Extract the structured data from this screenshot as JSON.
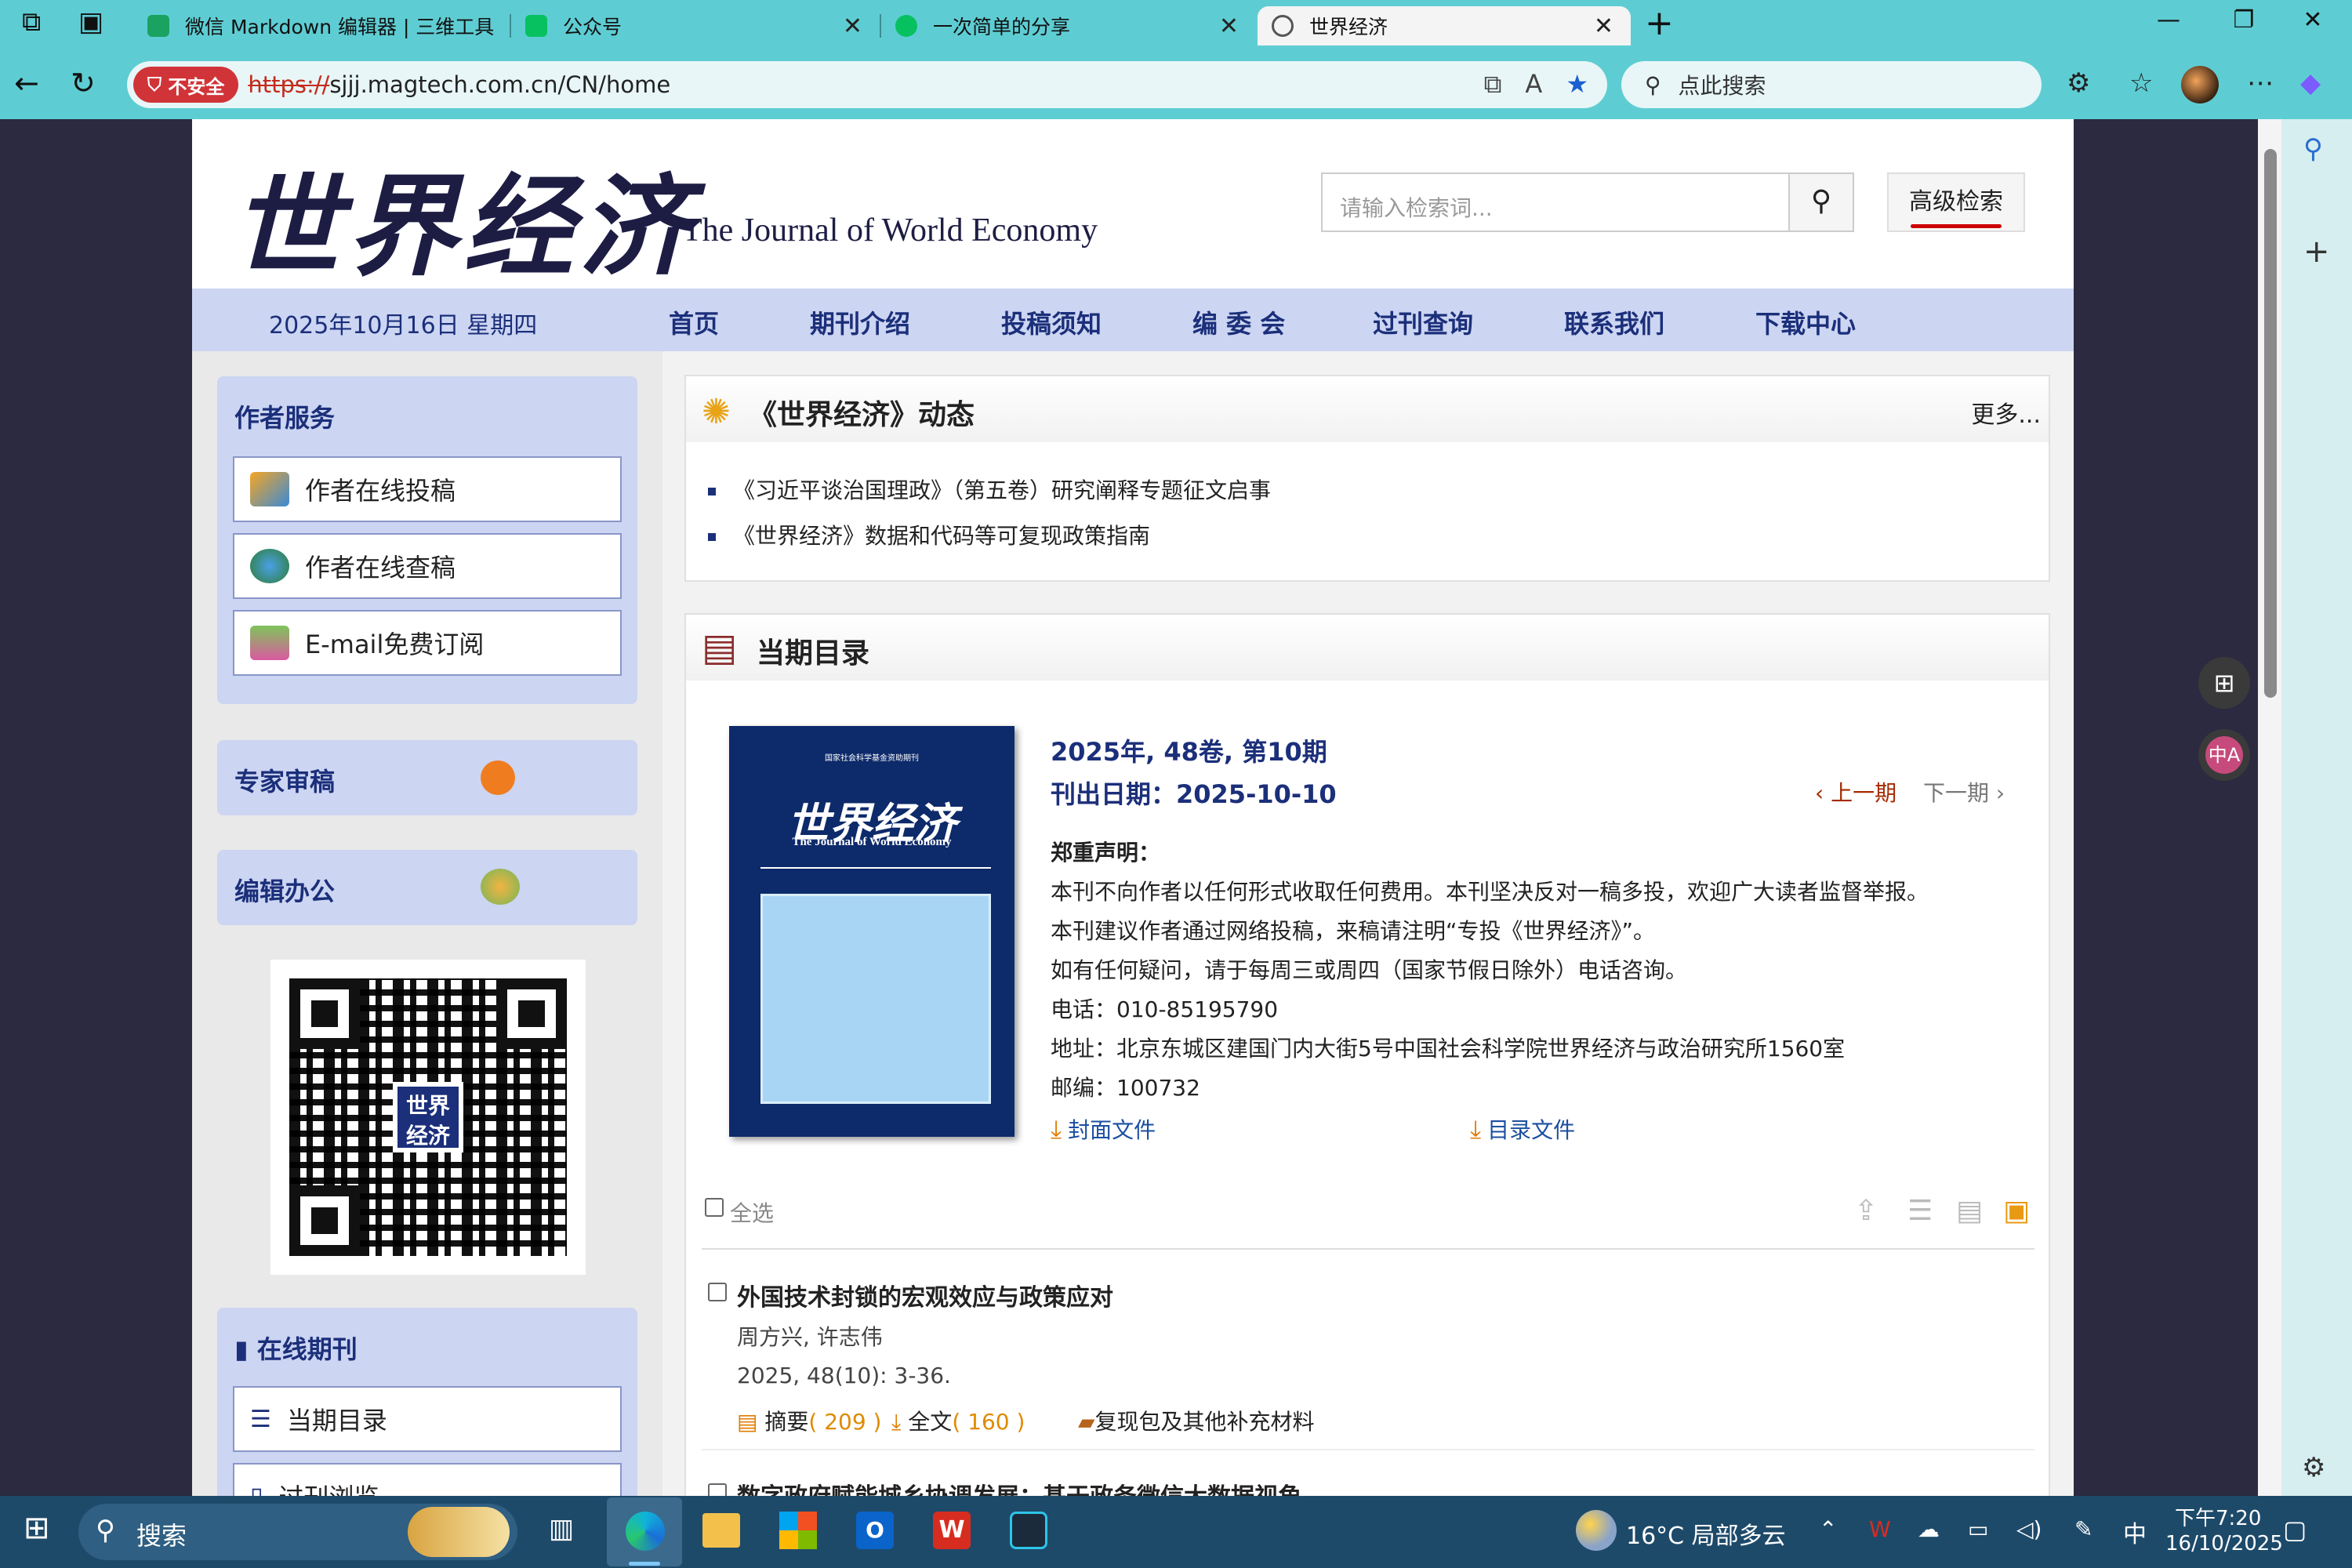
{
  "browser": {
    "tabs": [
      {
        "label": "微信 Markdown 编辑器 | 三维工具",
        "color": "#1aa260"
      },
      {
        "label": "公众号",
        "color": "#07c160"
      },
      {
        "label": "一次简单的分享",
        "color": "#07c160"
      },
      {
        "label": "世界经济",
        "color": "#555555"
      }
    ],
    "insecure_label": "不安全",
    "url_protocol": "https://",
    "url_rest": "sjjj.magtech.com.cn/CN/home",
    "search_placeholder": "点此搜索"
  },
  "site": {
    "logo_text": "世界经济",
    "journal_name_en": "The Journal of World Economy",
    "search_placeholder": "请输入检索词...",
    "advanced_search": "高级检索",
    "date": "2025年10月16日 星期四",
    "menu": [
      "首页",
      "期刊介绍",
      "投稿须知",
      "编 委 会",
      "过刊查询",
      "联系我们",
      "下载中心"
    ]
  },
  "sidebar": {
    "author_service_title": "作者服务",
    "author_buttons": [
      "作者在线投稿",
      "作者在线查稿",
      "E-mail免费订阅"
    ],
    "expert_review": "专家审稿",
    "editor_office": "编辑办公",
    "qr_logo": "世界经济",
    "online_journal_title": "在线期刊",
    "journal_buttons": [
      "当期目录",
      "过刊浏览"
    ]
  },
  "news": {
    "title": "《世界经济》动态",
    "more": "更多...",
    "items": [
      "《习近平谈治国理政》（第五卷）研究阐释专题征文启事",
      "《世界经济》数据和代码等可复现政策指南"
    ]
  },
  "current_issue": {
    "title": "当期目录",
    "cover_header": "国家社会科学基金资助期刊",
    "cover_logo": "世界经济",
    "cover_en": "The Journal of World Economy",
    "issue": "2025年, 48卷, 第10期",
    "pub_date": "刊出日期：2025-10-10",
    "prev": "上一期",
    "next": "下一期",
    "statement_title": "郑重声明：",
    "statement": [
      "本刊不向作者以任何形式收取任何费用。本刊坚决反对一稿多投，欢迎广大读者监督举报。",
      "本刊建议作者通过网络投稿，来稿请注明“专投《世界经济》”。",
      "如有任何疑问，请于每周三或周四（国家节假日除外）电话咨询。",
      "电话：010-85195790",
      "地址：北京东城区建国门内大街5号中国社会科学院世界经济与政治研究所1560室",
      "邮编：100732"
    ],
    "cover_file": "封面文件",
    "toc_file": "目录文件",
    "select_all": "全选"
  },
  "articles": [
    {
      "title": "外国技术封锁的宏观效应与政策应对",
      "authors": "周方兴, 许志伟",
      "citation": "2025, 48(10): 3-36.",
      "abstract_label": "摘要",
      "abstract_count": "( 209 )",
      "fulltext_label": "全文",
      "fulltext_count": "( 160 )",
      "supplement": "复现包及其他补充材料"
    },
    {
      "title": "数字政府赋能城乡协调发展：基于政务微信大数据视角"
    }
  ],
  "taskbar": {
    "search": "搜索",
    "weather": "16°C 局部多云",
    "ime": "中",
    "time": "下午7:20",
    "date": "16/10/2025"
  }
}
